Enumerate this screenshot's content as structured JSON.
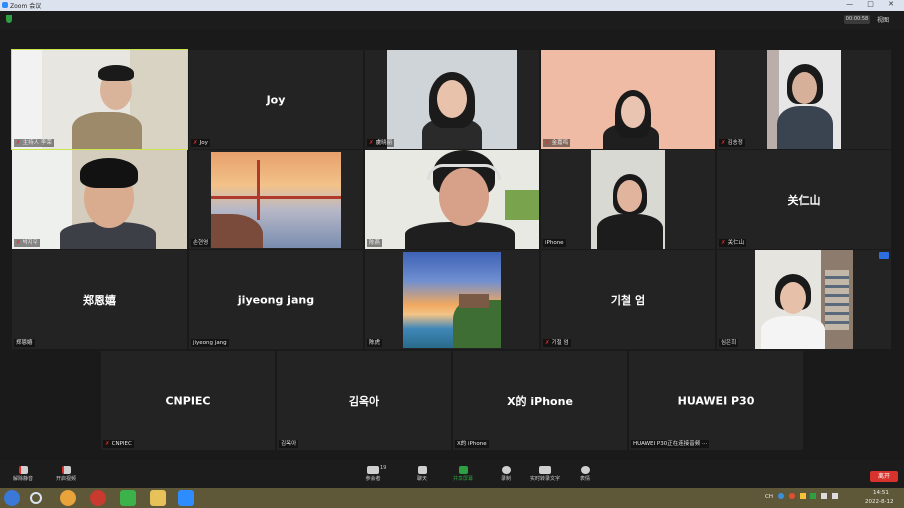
{
  "window": {
    "title": "Zoom 会议",
    "controls": "— □ ✕"
  },
  "header": {
    "timer": "00:00:58",
    "view_label": "视图"
  },
  "participants": {
    "p1": "主持人 李荣",
    "p2_big": "Joy",
    "p2": "Joy",
    "p3": "虞晓丽",
    "p4": "金嘉鸣",
    "p5": "김송정",
    "p6": "박지우",
    "p7": "손현영",
    "p8": "陈燕",
    "p9": "iPhone",
    "p10_big": "关仁山",
    "p10": "关仁山",
    "p11_big": "郑恩嬉",
    "p11": "郑恩嬉",
    "p12_big": "jiyeong jang",
    "p12": "jiyeong jang",
    "p13": "陈虎",
    "p14_big": "기철 엄",
    "p14": "기철 엄",
    "p15": "심은희",
    "p16_big": "CNPIEC",
    "p16": "CNPIEC",
    "p17_big": "김옥아",
    "p17": "김옥아",
    "p18_big": "X的 iPhone",
    "p18": "X的 iPhone",
    "p19_big": "HUAWEI P30",
    "p19": "HUAWEI P30正在连接音频 ···"
  },
  "toolbar": {
    "mute": "解除静音",
    "video": "开启视频",
    "participants_count": "19",
    "participants": "参会者",
    "chat": "聊天",
    "share": "共享屏幕",
    "record": "录制",
    "captions": "实时转录文字",
    "reactions": "表情",
    "end": "离开"
  },
  "system_tray": {
    "lang": "CH",
    "time": "14:51",
    "date": "2022-8-12"
  },
  "colors": {
    "active_speaker": "#c8e64c",
    "end_button": "#d8322c",
    "muted_icon": "#e0302b",
    "share_green": "#2ea043"
  }
}
